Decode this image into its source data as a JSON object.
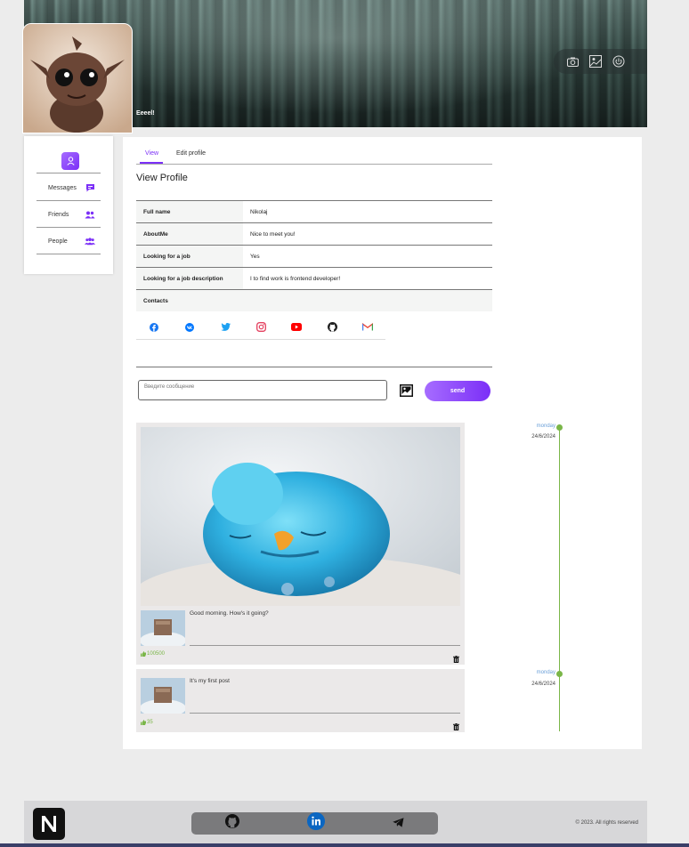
{
  "profile": {
    "username": "Eeeel!",
    "header_tools": [
      "camera-icon",
      "image-icon",
      "power-icon"
    ]
  },
  "sidebar": {
    "items": [
      {
        "label": "Messages",
        "icon": "chat-icon"
      },
      {
        "label": "Friends",
        "icon": "friends-icon"
      },
      {
        "label": "People",
        "icon": "people-icon"
      }
    ]
  },
  "tabs": [
    {
      "label": "View",
      "active": true
    },
    {
      "label": "Edit profile",
      "active": false
    }
  ],
  "page_title": "View Profile",
  "info": [
    {
      "key": "Full name",
      "value": "Nikolaj"
    },
    {
      "key": "AboutMe",
      "value": "Nice to meet you!"
    },
    {
      "key": "Looking for a job",
      "value": "Yes"
    },
    {
      "key": "Looking for a job description",
      "value": "I to find work is frontend developer!"
    }
  ],
  "contacts_label": "Contacts",
  "socials": [
    "facebook-icon",
    "vk-icon",
    "twitter-icon",
    "instagram-icon",
    "youtube-icon",
    "github-icon",
    "gmail-icon"
  ],
  "composer": {
    "placeholder": "Введите сообщение",
    "send_label": "send"
  },
  "posts": [
    {
      "text": "Good morning. How's it going?",
      "likes": "100500",
      "day": "monday",
      "date": "24/6/2024"
    },
    {
      "text": "It's my first post",
      "likes": "35",
      "day": "monday",
      "date": "24/6/2024"
    }
  ],
  "footer": {
    "links": [
      "github-icon",
      "linkedin-icon",
      "telegram-icon"
    ],
    "copyright": "© 2023. All rights reserved"
  },
  "colors": {
    "accent": "#7b2ff7",
    "likes_green": "#7ab648",
    "timeline_day": "#6a9fd8"
  }
}
